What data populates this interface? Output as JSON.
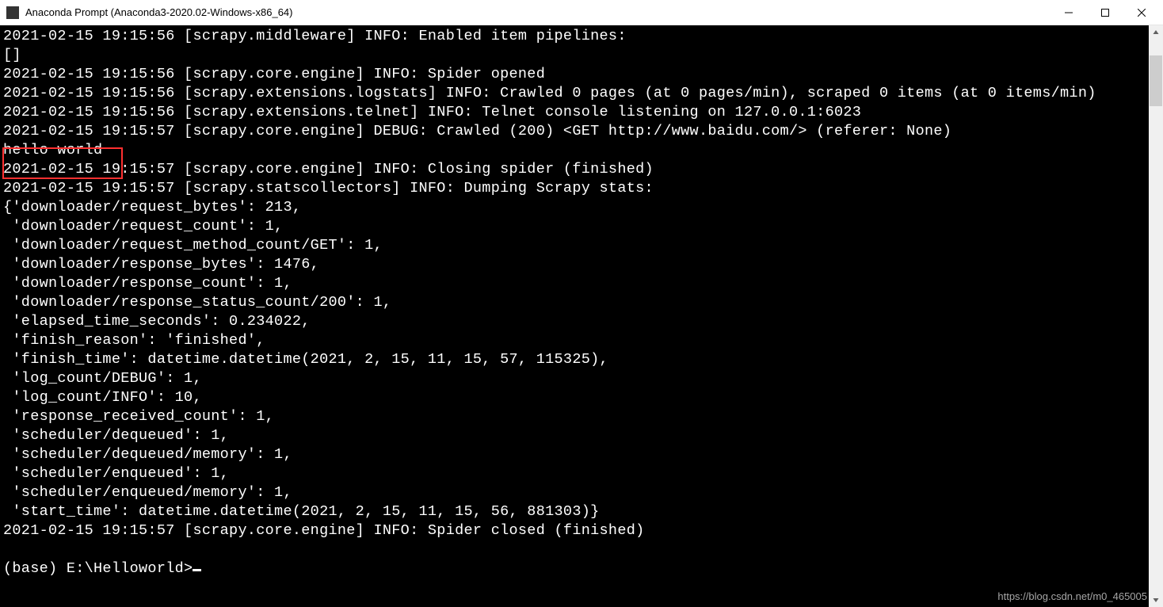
{
  "window": {
    "title": "Anaconda Prompt (Anaconda3-2020.02-Windows-x86_64)"
  },
  "terminal": {
    "lines": [
      "2021-02-15 19:15:56 [scrapy.middleware] INFO: Enabled item pipelines:",
      "[]",
      "2021-02-15 19:15:56 [scrapy.core.engine] INFO: Spider opened",
      "2021-02-15 19:15:56 [scrapy.extensions.logstats] INFO: Crawled 0 pages (at 0 pages/min), scraped 0 items (at 0 items/min)",
      "2021-02-15 19:15:56 [scrapy.extensions.telnet] INFO: Telnet console listening on 127.0.0.1:6023",
      "2021-02-15 19:15:57 [scrapy.core.engine] DEBUG: Crawled (200) <GET http://www.baidu.com/> (referer: None)",
      "hello world",
      "2021-02-15 19:15:57 [scrapy.core.engine] INFO: Closing spider (finished)",
      "2021-02-15 19:15:57 [scrapy.statscollectors] INFO: Dumping Scrapy stats:",
      "{'downloader/request_bytes': 213,",
      " 'downloader/request_count': 1,",
      " 'downloader/request_method_count/GET': 1,",
      " 'downloader/response_bytes': 1476,",
      " 'downloader/response_count': 1,",
      " 'downloader/response_status_count/200': 1,",
      " 'elapsed_time_seconds': 0.234022,",
      " 'finish_reason': 'finished',",
      " 'finish_time': datetime.datetime(2021, 2, 15, 11, 15, 57, 115325),",
      " 'log_count/DEBUG': 1,",
      " 'log_count/INFO': 10,",
      " 'response_received_count': 1,",
      " 'scheduler/dequeued': 1,",
      " 'scheduler/dequeued/memory': 1,",
      " 'scheduler/enqueued': 1,",
      " 'scheduler/enqueued/memory': 1,",
      " 'start_time': datetime.datetime(2021, 2, 15, 11, 15, 56, 881303)}",
      "2021-02-15 19:15:57 [scrapy.core.engine] INFO: Spider closed (finished)",
      "",
      "(base) E:\\Helloworld>"
    ]
  },
  "watermark": "https://blog.csdn.net/m0_465005"
}
